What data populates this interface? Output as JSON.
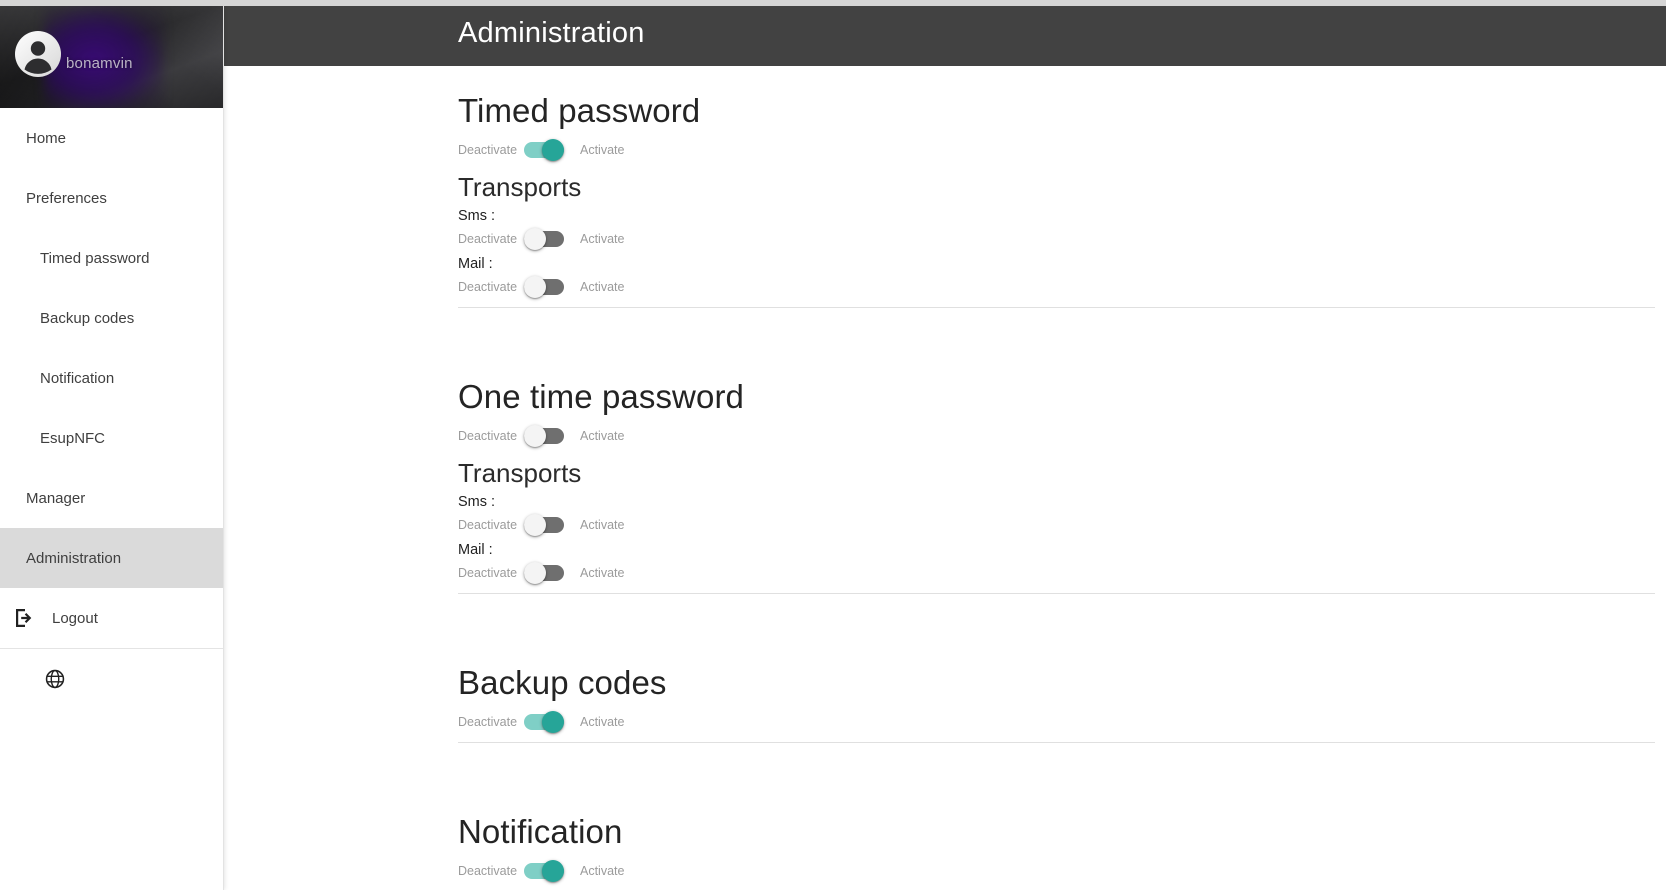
{
  "sidebar": {
    "profile": {
      "username": "bonamvin",
      "avatar_icon": "account-circle-icon"
    },
    "items": [
      {
        "label": "Home",
        "level": "top",
        "active": false
      },
      {
        "label": "Preferences",
        "level": "top",
        "active": false
      },
      {
        "label": "Timed password",
        "level": "sub",
        "active": false
      },
      {
        "label": "Backup codes",
        "level": "sub",
        "active": false
      },
      {
        "label": "Notification",
        "level": "sub",
        "active": false
      },
      {
        "label": "EsupNFC",
        "level": "sub",
        "active": false
      },
      {
        "label": "Manager",
        "level": "top",
        "active": false
      },
      {
        "label": "Administration",
        "level": "top",
        "active": true
      }
    ],
    "logout": {
      "label": "Logout",
      "icon": "logout-arrow-icon"
    },
    "language": {
      "icon": "globe-icon"
    }
  },
  "header": {
    "title": "Administration"
  },
  "toggle_labels": {
    "off": "Deactivate",
    "on": "Activate"
  },
  "sections": [
    {
      "title": "Timed password",
      "main_toggle": {
        "state": "on"
      },
      "transports": {
        "title": "Transports",
        "fields": [
          {
            "label": "Sms :",
            "state": "off"
          },
          {
            "label": "Mail :",
            "state": "off"
          }
        ]
      }
    },
    {
      "title": "One time password",
      "main_toggle": {
        "state": "off"
      },
      "transports": {
        "title": "Transports",
        "fields": [
          {
            "label": "Sms :",
            "state": "off"
          },
          {
            "label": "Mail :",
            "state": "off"
          }
        ]
      }
    },
    {
      "title": "Backup codes",
      "main_toggle": {
        "state": "on"
      },
      "transports": null
    },
    {
      "title": "Notification",
      "main_toggle": {
        "state": "on"
      },
      "transports": null
    }
  ],
  "colors": {
    "accent_on_knob": "#26a598",
    "accent_on_track": "#7fcfc6",
    "off_track": "#6f6f6f",
    "header_bar": "#424242",
    "active_nav": "#dadada"
  }
}
